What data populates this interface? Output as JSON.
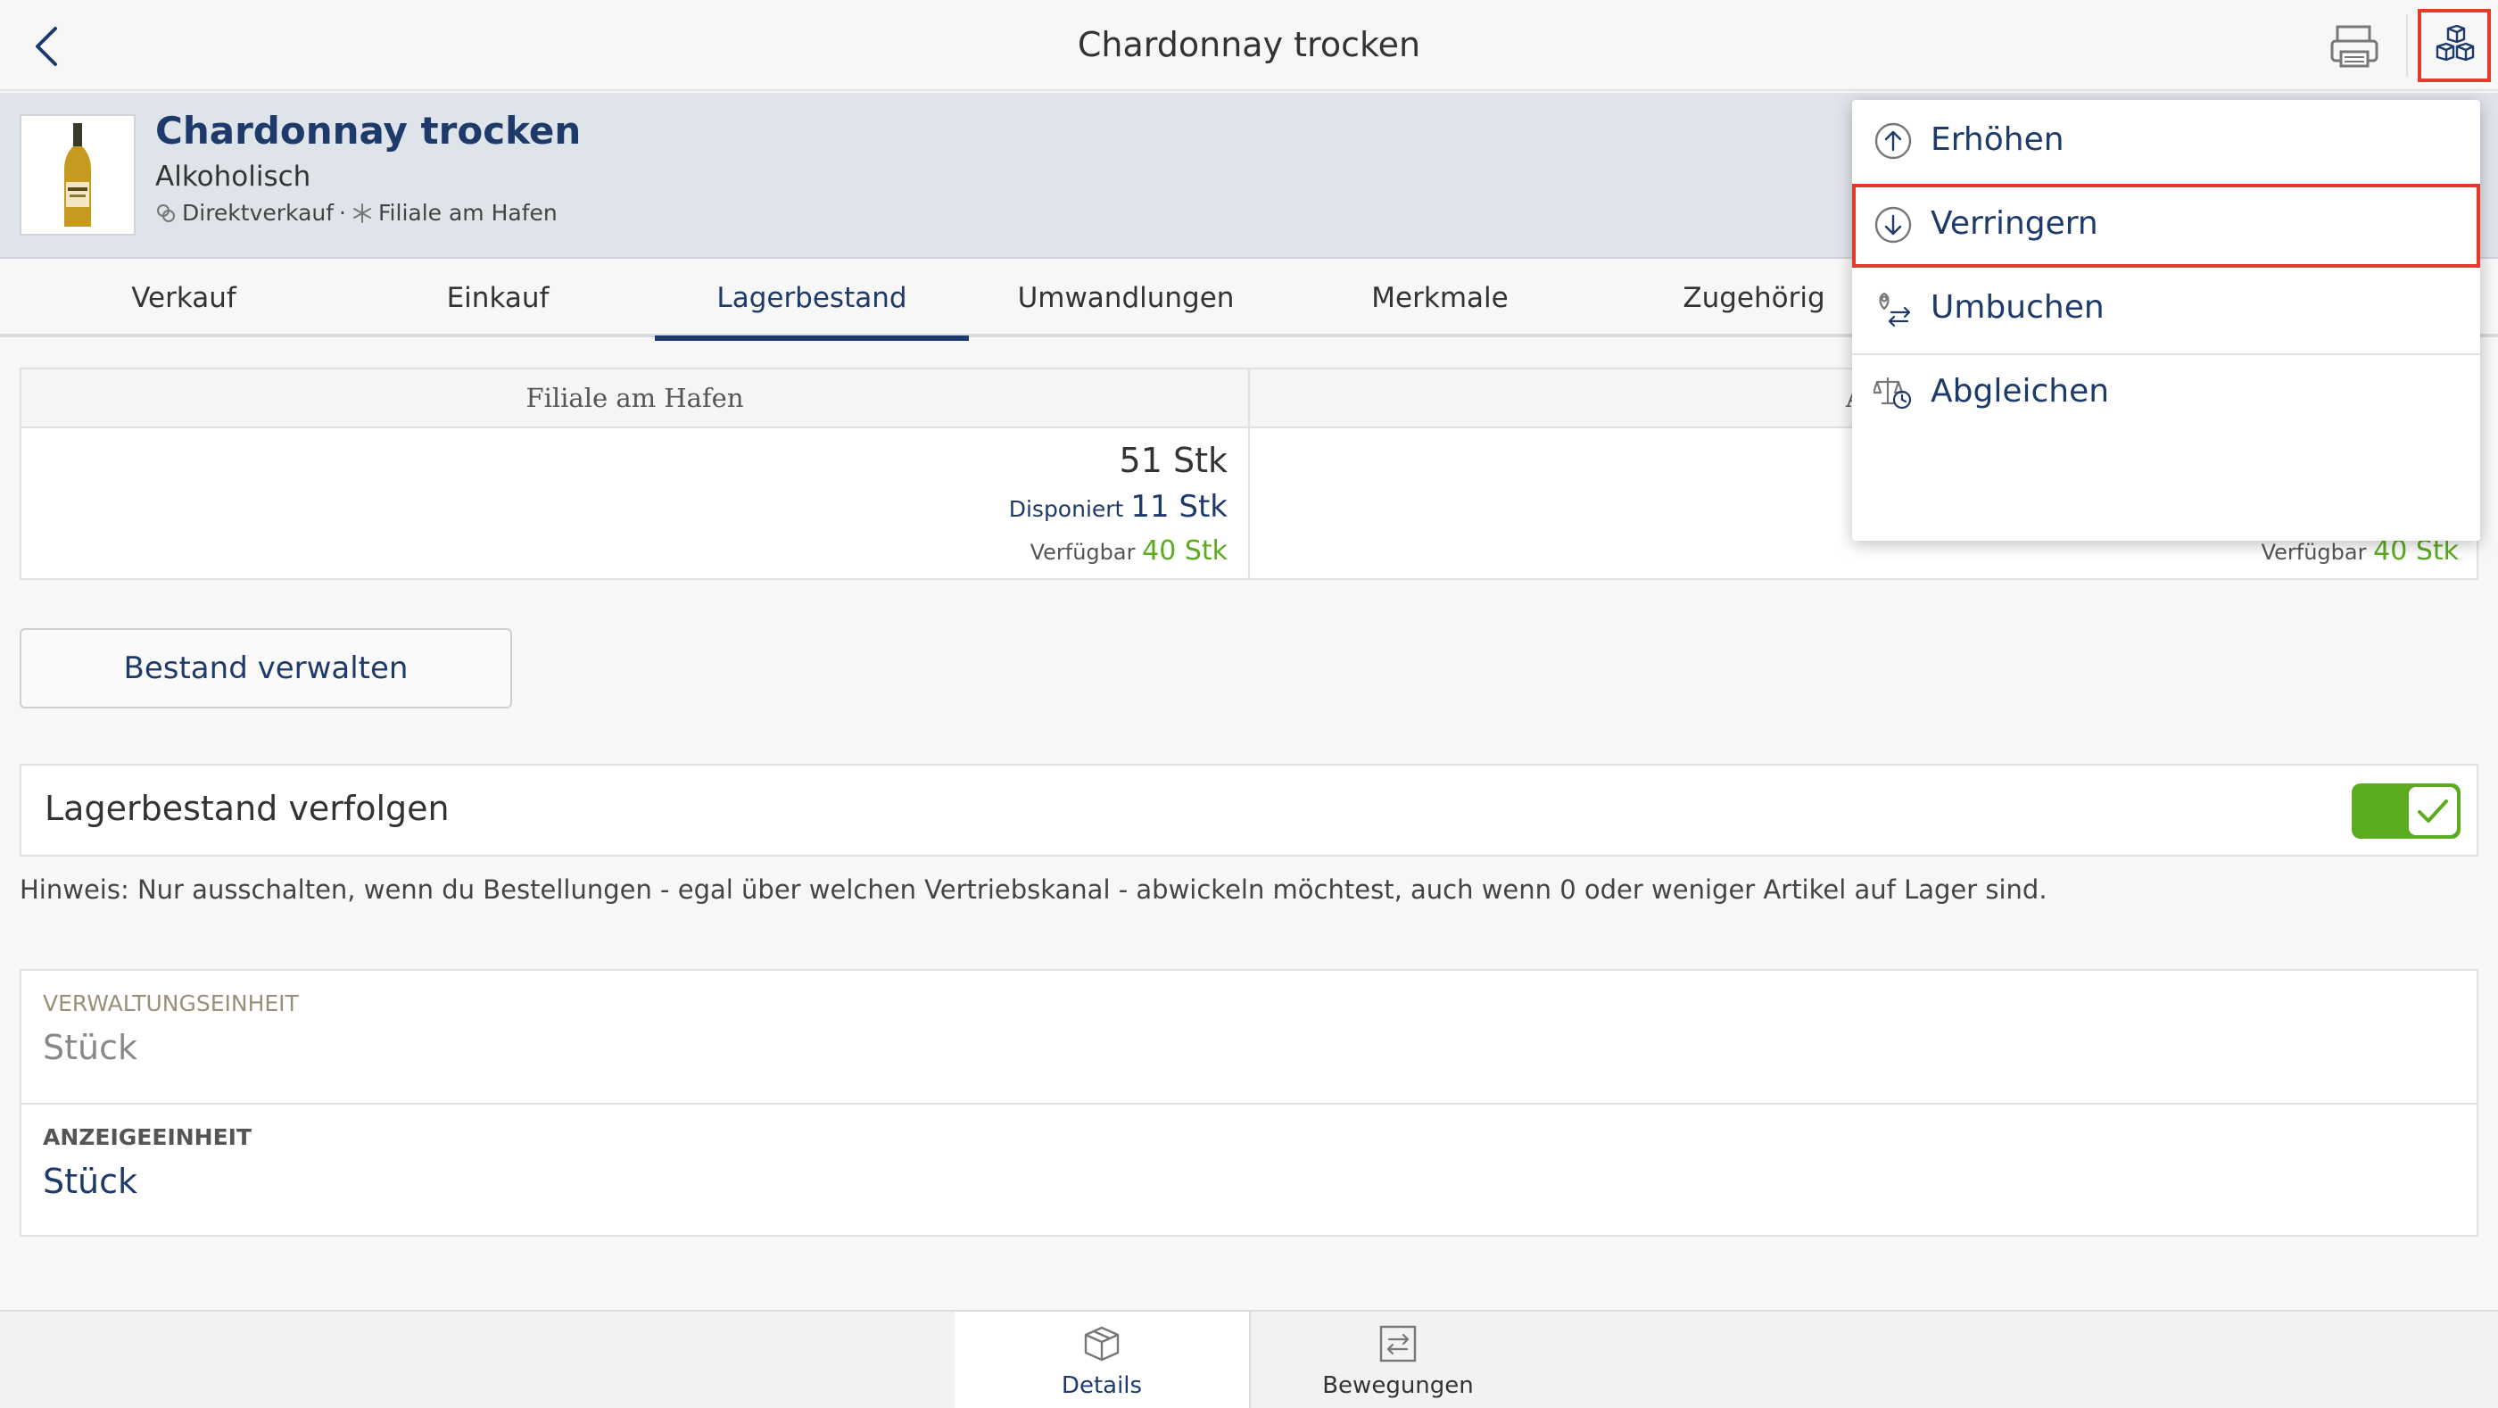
{
  "topbar": {
    "title": "Chardonnay trocken"
  },
  "product": {
    "name": "Chardonnay trocken",
    "category": "Alkoholisch",
    "tag_sales": "Direktverkauf",
    "tag_separator": "·",
    "tag_location": "Filiale am Hafen"
  },
  "tabs": [
    {
      "label": "Verkauf"
    },
    {
      "label": "Einkauf"
    },
    {
      "label": "Lagerbestand"
    },
    {
      "label": "Umwandlungen"
    },
    {
      "label": "Merkmale"
    },
    {
      "label": "Zugehörig"
    }
  ],
  "stock": {
    "locations": [
      {
        "name": "Filiale am Hafen",
        "total": "51 Stk",
        "disposed_label": "Disponiert",
        "disposed": "11 Stk",
        "available_label": "Verfügbar",
        "available": "40 Stk"
      },
      {
        "name": "A",
        "available_label": "Verfügbar",
        "available": "40 Stk"
      }
    ]
  },
  "manage_button": "Bestand verwalten",
  "tracking": {
    "label": "Lagerbestand verfolgen",
    "enabled": true,
    "hint": "Hinweis: Nur ausschalten, wenn du Bestellungen - egal über welchen Vertriebskanal - abwickeln möchtest, auch wenn 0 oder weniger Artikel auf Lager sind."
  },
  "units": {
    "management_label": "VERWALTUNGSEINHEIT",
    "management_value": "Stück",
    "display_label": "ANZEIGEEINHEIT",
    "display_value": "Stück"
  },
  "bottom_tabs": [
    {
      "label": "Details",
      "icon": "box-icon"
    },
    {
      "label": "Bewegungen",
      "icon": "transfer-icon"
    }
  ],
  "stock_menu": {
    "items": [
      {
        "label": "Erhöhen",
        "icon": "arrow-up-circle-icon"
      },
      {
        "label": "Verringern",
        "icon": "arrow-down-circle-icon"
      },
      {
        "label": "Umbuchen",
        "icon": "rebook-icon"
      },
      {
        "label": "Abgleichen",
        "icon": "balance-scale-icon"
      }
    ]
  },
  "colors": {
    "navy": "#1d3a6b",
    "accent_green": "#5bab1e",
    "highlight_red": "#e23b2e",
    "header_bg": "#dfe3ea"
  }
}
